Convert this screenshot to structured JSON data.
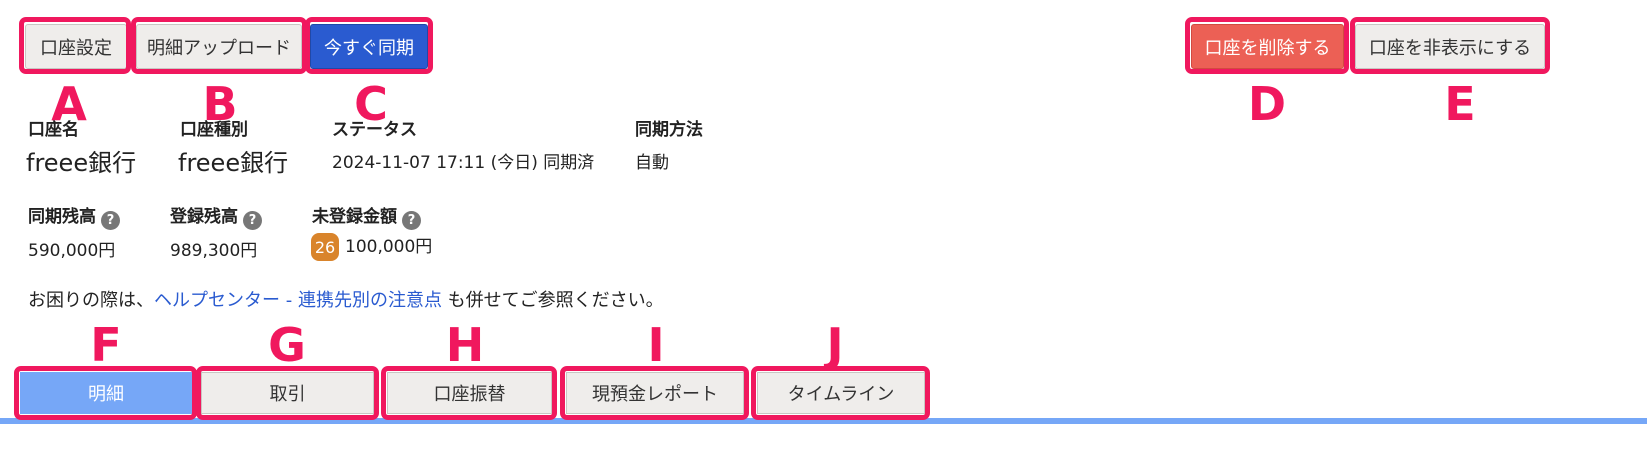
{
  "toolbar": {
    "account_settings": "口座設定",
    "upload_statements": "明細アップロード",
    "sync_now": "今すぐ同期",
    "delete_account": "口座を削除する",
    "hide_account": "口座を非表示にする"
  },
  "markers": [
    "A",
    "B",
    "C",
    "D",
    "E",
    "F",
    "G",
    "H",
    "I",
    "J"
  ],
  "account": {
    "name_label": "口座名",
    "name": "freee銀行",
    "type_label": "口座種別",
    "type": "freee銀行",
    "status_label": "ステータス",
    "status": "2024-11-07 17:11 (今日) 同期済",
    "sync_method_label": "同期方法",
    "sync_method": "自動"
  },
  "balances": {
    "synced_label": "同期残高",
    "synced": "590,000円",
    "registered_label": "登録残高",
    "registered": "989,300円",
    "unregistered_label": "未登録金額",
    "unregistered_count": "26",
    "unregistered": "100,000円",
    "help_glyph": "?"
  },
  "note": {
    "prefix": "お困りの際は、",
    "link1": "ヘルプセンター",
    "sep": " - ",
    "link2": "連携先別の注意点",
    "suffix": " も併せてご参照ください。"
  },
  "tabs": [
    {
      "label": "明細",
      "active": true
    },
    {
      "label": "取引",
      "active": false
    },
    {
      "label": "口座振替",
      "active": false
    },
    {
      "label": "現預金レポート",
      "active": false
    },
    {
      "label": "タイムライン",
      "active": false
    }
  ],
  "colors": {
    "highlight": "#f0185e",
    "primary": "#2a5bd0",
    "danger": "#ec6055",
    "active_tab": "#76a7f7",
    "badge": "#d9842b"
  }
}
